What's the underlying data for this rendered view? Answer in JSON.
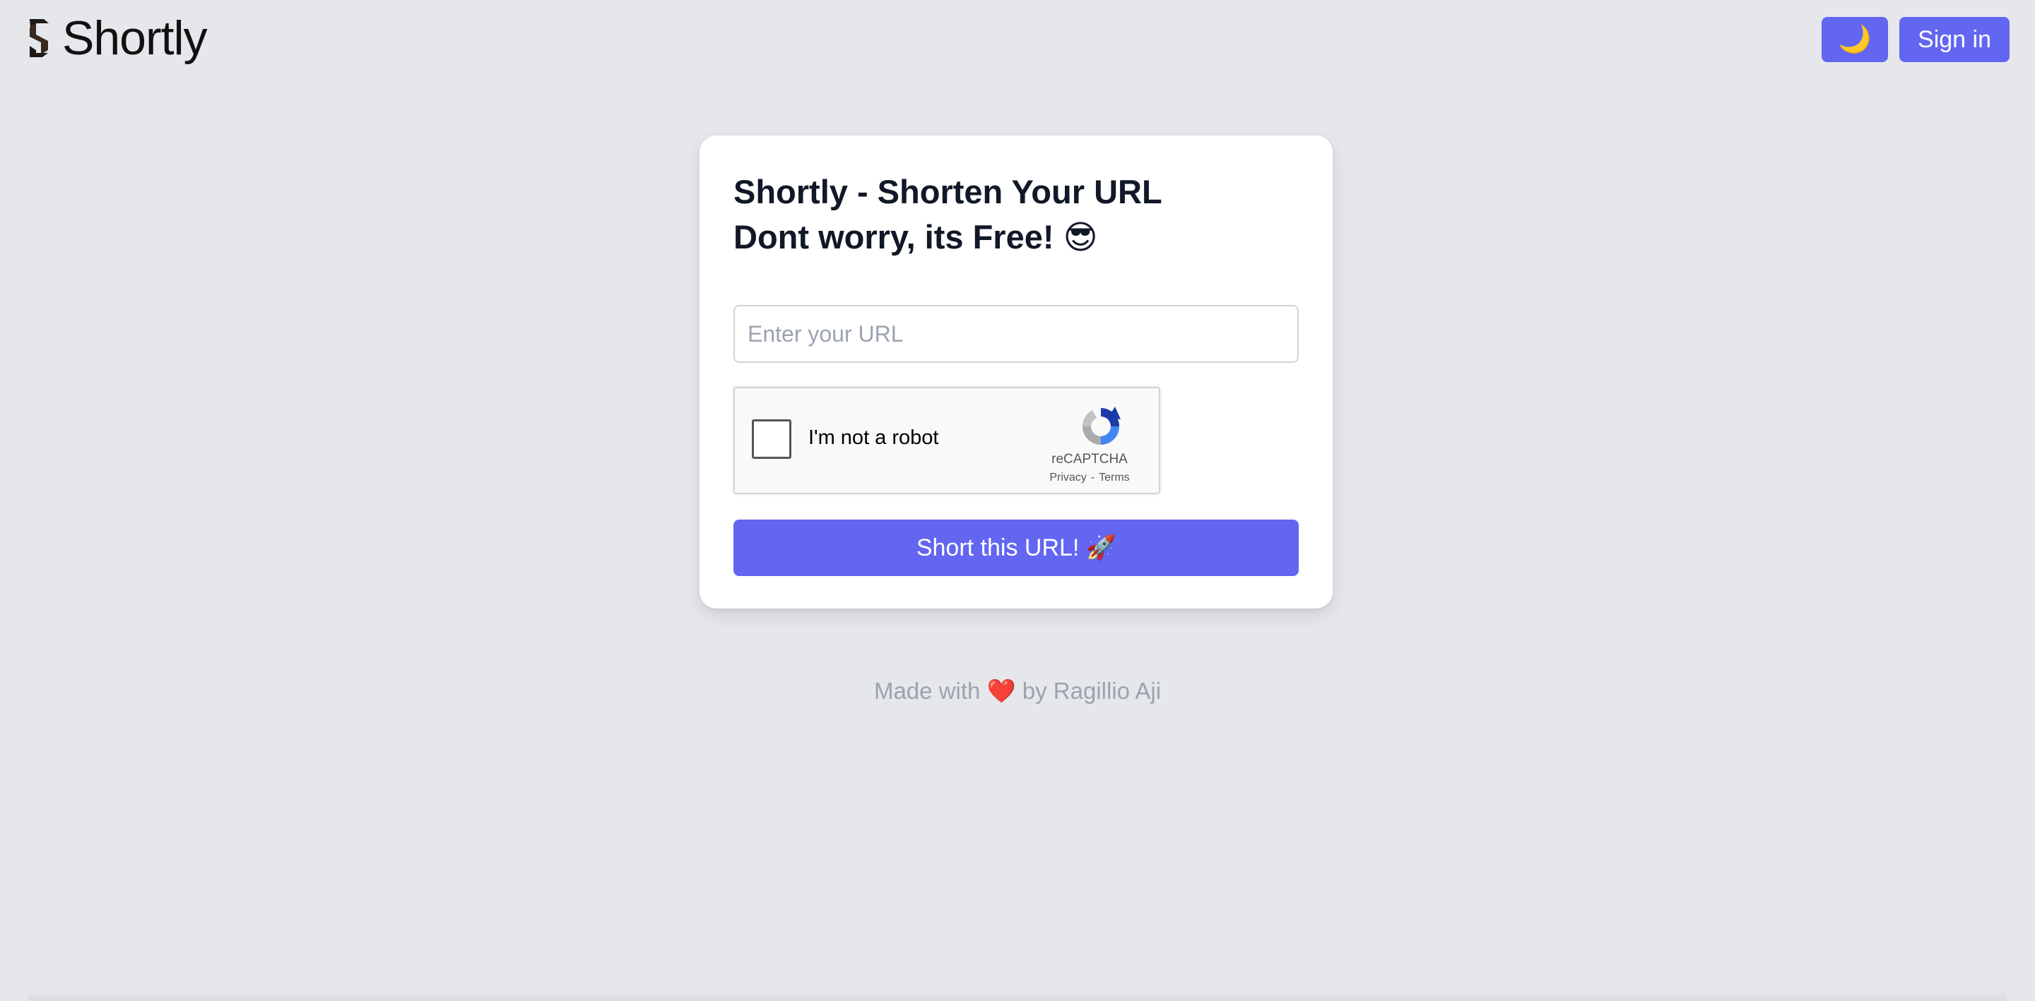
{
  "app": {
    "name": "Shortly"
  },
  "header": {
    "theme_toggle_icon": "🌙",
    "theme_toggle_icon_name": "moon-icon",
    "sign_in_label": "Sign in"
  },
  "card": {
    "title_line1": "Shortly - Shorten Your URL",
    "title_line2": "Dont worry, its Free! 😎",
    "url_input": {
      "value": "",
      "placeholder": "Enter your URL"
    },
    "recaptcha": {
      "label": "I'm not a robot",
      "checked": false,
      "brand": "reCAPTCHA",
      "privacy": "Privacy",
      "separator": "-",
      "terms": "Terms"
    },
    "submit_label": "Short this URL! 🚀"
  },
  "footer": {
    "text": "Made with ❤️ by Ragillio Aji"
  },
  "colors": {
    "background": "#e5e7eb",
    "accent": "#6366f1",
    "card": "#ffffff",
    "title_text": "#111827",
    "muted_text": "#9ca3af"
  }
}
